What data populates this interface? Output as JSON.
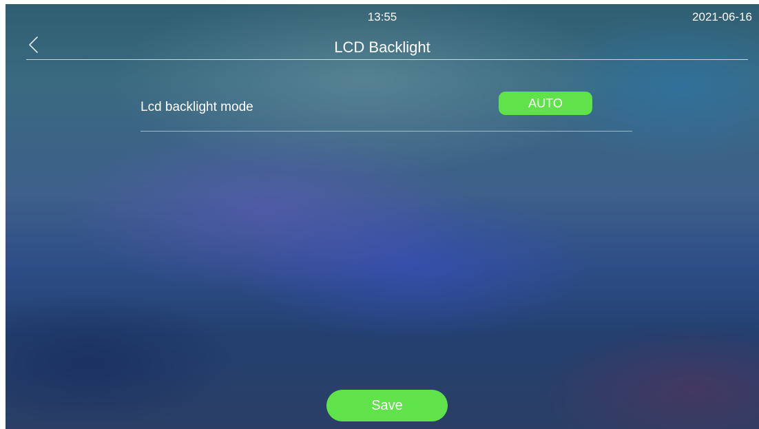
{
  "status_bar": {
    "time": "13:55",
    "date": "2021-06-16"
  },
  "header": {
    "title": "LCD Backlight",
    "back_icon": "chevron-left-icon"
  },
  "settings": {
    "backlight_mode": {
      "label": "Lcd backlight mode",
      "value": "AUTO"
    }
  },
  "actions": {
    "save_label": "Save"
  },
  "colors": {
    "accent_green": "#5fe24a",
    "text": "#ffffff"
  }
}
